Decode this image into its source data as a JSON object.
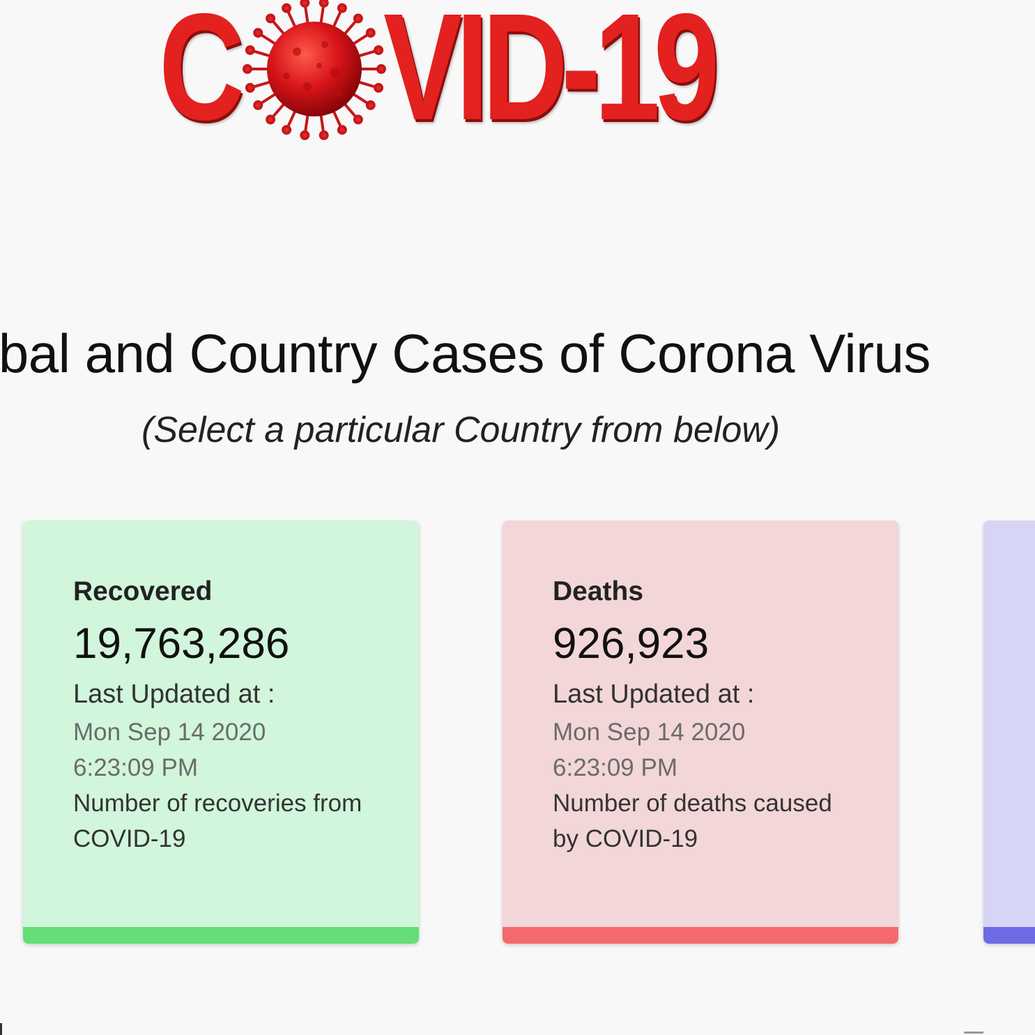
{
  "logo": {
    "text_left": "C",
    "text_right": "VID-19"
  },
  "headline": "obal and Country Cases of Corona Virus",
  "subline": "(Select a particular Country from below)",
  "cards": [
    {
      "key": "recovered",
      "title": "Recovered",
      "value": "19,763,286",
      "updated_label": "Last Updated at :",
      "updated_date": "Mon Sep 14 2020 6:23:09 PM",
      "description": "Number of recoveries from COVID-19",
      "bar_color": "#66dd77"
    },
    {
      "key": "deaths",
      "title": "Deaths",
      "value": "926,923",
      "updated_label": "Last Updated at :",
      "updated_date": "Mon Sep 14 2020 6:23:09 PM",
      "description": "Number of deaths caused by COVID-19",
      "bar_color": "#f46a6c"
    },
    {
      "key": "active",
      "bar_color": "#6e6be6"
    }
  ],
  "colors": {
    "background": "#f8f8f8",
    "logo_red": "#e3211f",
    "recovered_bg": "#d1f6db",
    "deaths_bg": "#f3d6d7",
    "active_bg": "#d6d5f5"
  }
}
